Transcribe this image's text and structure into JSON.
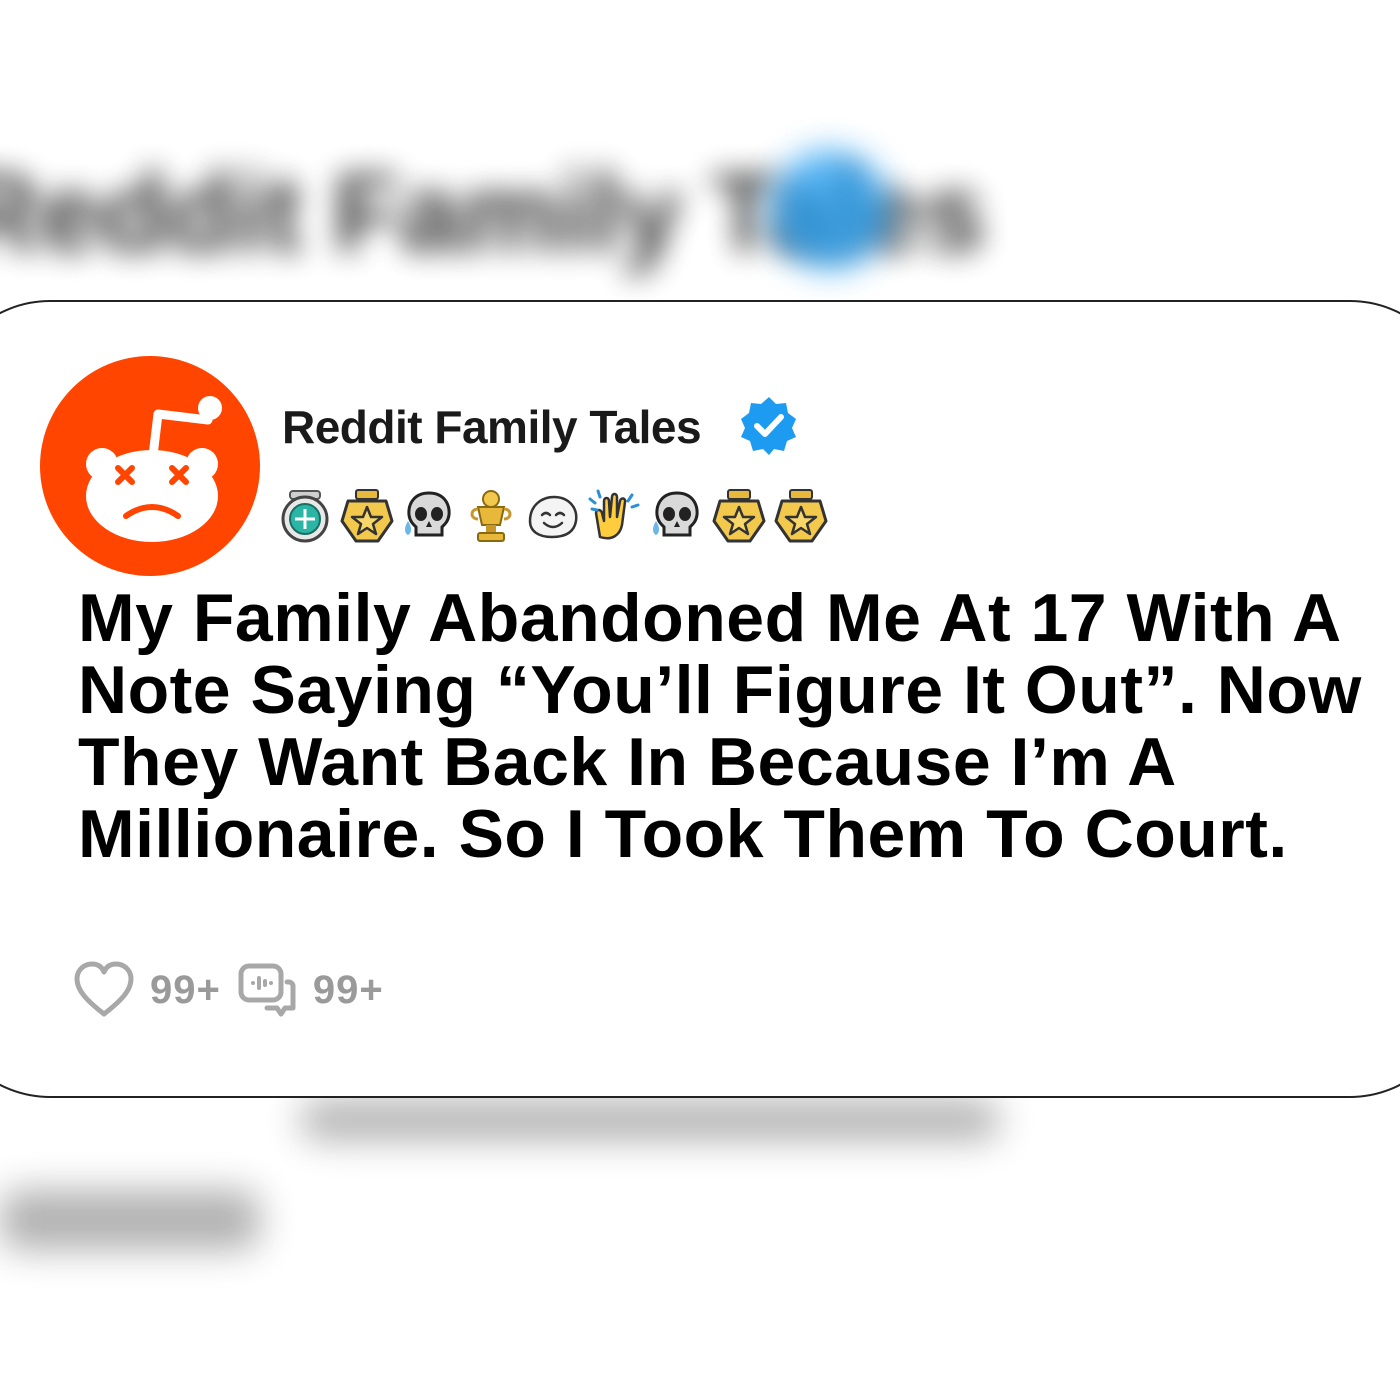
{
  "background": {
    "blurred_title": "Reddit Family Tales"
  },
  "post": {
    "account_name": "Reddit Family Tales",
    "verified": true,
    "avatar_icon": "reddit-snoo-dizzy-icon",
    "awards": [
      {
        "icon": "teal-gem-award-icon"
      },
      {
        "icon": "gold-star-award-icon"
      },
      {
        "icon": "crying-skull-award-icon"
      },
      {
        "icon": "gold-trophy-award-icon"
      },
      {
        "icon": "laughing-ghost-award-icon"
      },
      {
        "icon": "clapping-hands-award-icon"
      },
      {
        "icon": "crying-skull-award-icon"
      },
      {
        "icon": "gold-star-award-icon"
      },
      {
        "icon": "gold-star-award-icon"
      }
    ],
    "title": "My Family Abandoned Me At 17 With A Note Saying “You’ll Figure It Out”. Now They Want Back In Because I’m A Millionaire. So I Took Them To Court.",
    "likes_count": "99+",
    "comments_count": "99+"
  },
  "colors": {
    "avatar_bg": "#ff4500",
    "verified_blue": "#1d9bf0",
    "stat_gray": "#9a9a9a",
    "gold": "#e8b83a"
  }
}
